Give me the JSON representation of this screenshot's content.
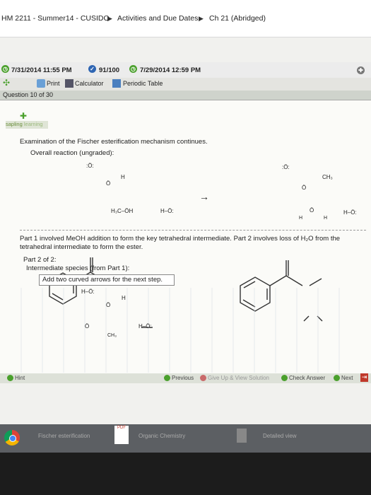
{
  "breadcrumb": {
    "course": "HM 2211 - Summer14 - CUSIDO",
    "activities": "Activities and Due Dates",
    "chapter": "Ch 21 (Abridged)"
  },
  "status": {
    "due_date": "7/31/2014 11:55 PM",
    "score": "91/100",
    "print_date": "7/29/2014 12:59 PM"
  },
  "toolbar": {
    "print": "Print",
    "calculator": "Calculator",
    "periodic_table": "Periodic Table"
  },
  "question": {
    "label": "Question 10 of 30"
  },
  "sapling": {
    "brand": "sapling",
    "sub": "learning"
  },
  "problem": {
    "intro": "Examination of the Fischer esterification mechanism continues.",
    "overall": "Overall reaction (ungraded):",
    "part1_line1": "Part 1 involved MeOH addition to form the key tetrahedral intermediate. Part 2 involves loss of H₂O from the",
    "part1_line2": "tetrahedral intermediate to form the ester.",
    "part2": "Part 2 of 2:",
    "intermediate": "Intermediate species (from Part 1):",
    "instruction": "Add two curved arrows for the next step."
  },
  "chem": {
    "methanol": "H₃C–ÖH",
    "h_o": "H–Ö:",
    "ch3": "CH₃",
    "h_label": "H",
    "o_label": ":Ö:",
    "oplus": "Ö",
    "arrow": "→"
  },
  "nav": {
    "hint": "Hint",
    "previous": "Previous",
    "give_up": "Give Up & View Solution",
    "check": "Check Answer",
    "next": "Next"
  },
  "taskbar": {
    "item1": "Fischer esterification",
    "item2": "Organic Chemistry",
    "item3": "Detailed view",
    "pdf": "PDF"
  },
  "colors": {
    "green": "#4aa02c",
    "blue": "#2f66b3",
    "red": "#c0392b"
  }
}
